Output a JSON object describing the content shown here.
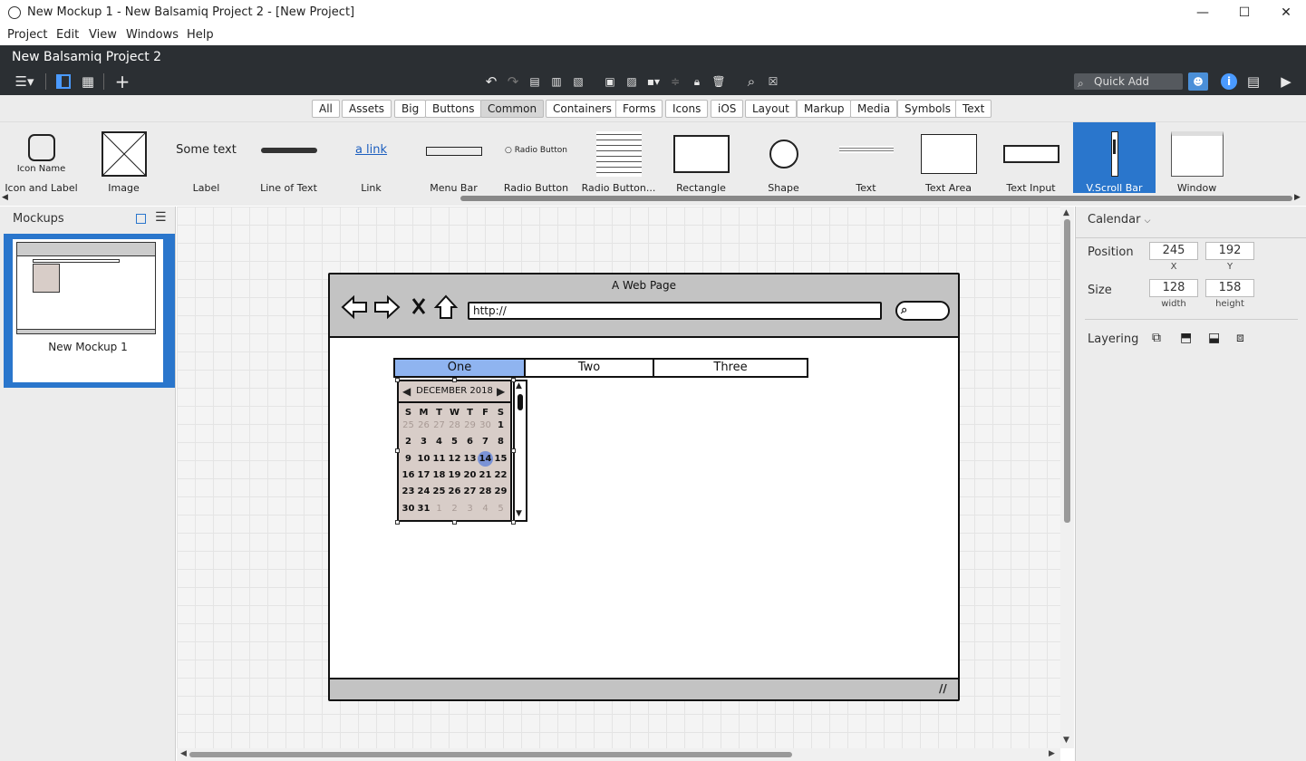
{
  "window": {
    "title": "New Mockup 1 - New Balsamiq Project 2 - [New Project]",
    "min": "—",
    "max": "☐",
    "close": "✕"
  },
  "menu": [
    "Project",
    "Edit",
    "View",
    "Windows",
    "Help"
  ],
  "project_name": "New Balsamiq Project 2",
  "quick_add_placeholder": "Quick Add",
  "categories": [
    "All",
    "Assets",
    "Big",
    "Buttons",
    "Common",
    "Containers",
    "Forms",
    "Icons",
    "iOS",
    "Layout",
    "Markup",
    "Media",
    "Symbols",
    "Text"
  ],
  "selected_category": "Common",
  "library": [
    {
      "label": "Icon and Label",
      "preview_text": "Icon Name"
    },
    {
      "label": "Image"
    },
    {
      "label": "Label",
      "preview_text": "Some text"
    },
    {
      "label": "Line of Text"
    },
    {
      "label": "Link",
      "preview_text": "a link"
    },
    {
      "label": "Menu Bar"
    },
    {
      "label": "Radio Button",
      "preview_text": "Radio Button"
    },
    {
      "label": "Radio Button..."
    },
    {
      "label": "Rectangle"
    },
    {
      "label": "Shape"
    },
    {
      "label": "Text"
    },
    {
      "label": "Text Area"
    },
    {
      "label": "Text Input"
    },
    {
      "label": "V.Scroll Bar"
    },
    {
      "label": "Window"
    }
  ],
  "selected_library_item": "V.Scroll Bar",
  "mockups_panel": {
    "title": "Mockups",
    "items": [
      {
        "name": "New Mockup 1"
      }
    ]
  },
  "inspector": {
    "title": "Calendar",
    "position_label": "Position",
    "x": "245",
    "y": "192",
    "x_label": "X",
    "y_label": "Y",
    "size_label": "Size",
    "width": "128",
    "height": "158",
    "width_label": "width",
    "height_label": "height",
    "layering_label": "Layering"
  },
  "mockup": {
    "browser_title": "A Web Page",
    "url": "http://",
    "tabs": [
      "One",
      "Two",
      "Three"
    ],
    "selected_tab": "One",
    "calendar": {
      "month": "DECEMBER 2018",
      "weekdays": [
        "S",
        "M",
        "T",
        "W",
        "T",
        "F",
        "S"
      ],
      "weeks": [
        [
          "25",
          "26",
          "27",
          "28",
          "29",
          "30",
          "1"
        ],
        [
          "2",
          "3",
          "4",
          "5",
          "6",
          "7",
          "8"
        ],
        [
          "9",
          "10",
          "11",
          "12",
          "13",
          "14",
          "15"
        ],
        [
          "16",
          "17",
          "18",
          "19",
          "20",
          "21",
          "22"
        ],
        [
          "23",
          "24",
          "25",
          "26",
          "27",
          "28",
          "29"
        ],
        [
          "30",
          "31",
          "1",
          "2",
          "3",
          "4",
          "5"
        ]
      ],
      "selected_day": "14"
    }
  },
  "colors": {
    "accent": "#2a76cc",
    "dark_toolbar": "#2b2f33",
    "selected_tab": "#8fb4f0",
    "calendar_bg": "#d8cdc8",
    "selected_day": "#7b93d6"
  }
}
